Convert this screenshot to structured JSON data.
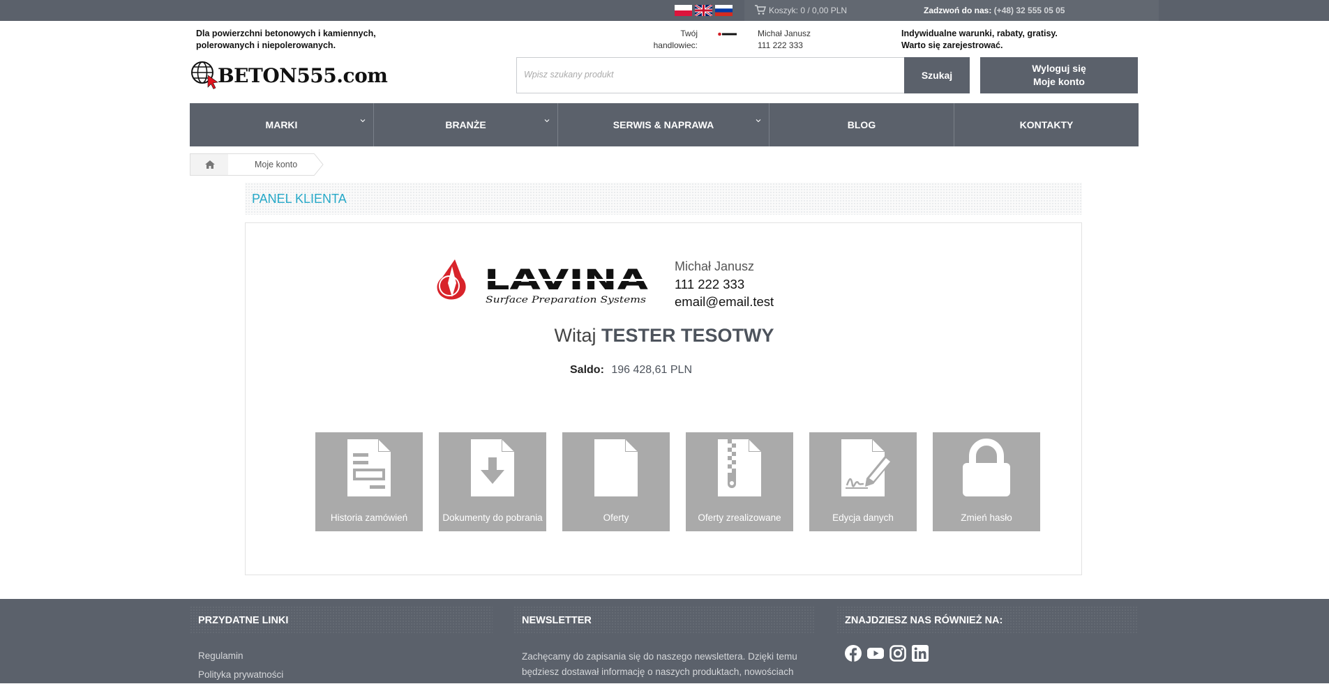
{
  "topbar": {
    "flags": [
      "pl-flag",
      "uk-flag",
      "ru-flag"
    ],
    "cart_text": "Koszyk: 0 / 0,00 PLN",
    "phone_label": "Zadzwoń do nas:",
    "phone_number": "(+48) 32 555 05 05"
  },
  "header": {
    "tagline_line1": "Dla powierzchni betonowych i kamiennych,",
    "tagline_line2": "polerowanych i niepolerowanych.",
    "logo_text": "BETON555.com",
    "rep_label_line1": "Twój",
    "rep_label_line2": "handlowiec:",
    "rep_name": "Michał Janusz",
    "rep_phone": "111 222 333",
    "promo_line1": "Indywidualne warunki, rabaty, gratisy.",
    "promo_line2": "Warto się zarejestrować.",
    "search_placeholder": "Wpisz szukany produkt",
    "search_button": "Szukaj",
    "logout_label": "Wyloguj się",
    "account_label": "Moje konto"
  },
  "nav": {
    "items": [
      {
        "label": "MARKI",
        "dropdown": true
      },
      {
        "label": "BRANŻE",
        "dropdown": true
      },
      {
        "label": "SERWIS & NAPRAWA",
        "dropdown": true
      },
      {
        "label": "BLOG",
        "dropdown": false
      },
      {
        "label": "KONTAKTY",
        "dropdown": false
      }
    ]
  },
  "breadcrumb": {
    "home_icon": "home-icon",
    "current": "Moje konto"
  },
  "panel": {
    "title": "PANEL KLIENTA",
    "brand_logo_text": "LAVINA",
    "brand_logo_subtext": "Surface Preparation Systems",
    "contact_name": "Michał Janusz",
    "contact_phone": "111 222 333",
    "contact_email": "email@email.test",
    "welcome_prefix": "Witaj",
    "welcome_name": "TESTER TESOTWY",
    "balance_label": "Saldo:",
    "balance_value": "196 428,61 PLN",
    "tiles": [
      {
        "label": "Historia zamówień",
        "icon": "order-history-icon"
      },
      {
        "label": "Dokumenty do pobrania",
        "icon": "download-document-icon"
      },
      {
        "label": "Oferty",
        "icon": "document-icon"
      },
      {
        "label": "Oferty zrealizowane",
        "icon": "zip-document-icon"
      },
      {
        "label": "Edycja danych",
        "icon": "signature-edit-icon"
      },
      {
        "label": "Zmień hasło",
        "icon": "lock-icon"
      }
    ]
  },
  "footer": {
    "useful_links_title": "PRZYDATNE LINKI",
    "links": [
      "Regulamin",
      "Polityka prywatności"
    ],
    "newsletter_title": "NEWSLETTER",
    "newsletter_text": "Zachęcamy do zapisania się do naszego newslettera. Dzięki temu będziesz dostawał informację o naszych produktach, nowościach",
    "social_title": "ZNAJDZIESZ NAS RÓWNIEŻ NA:",
    "social_icons": [
      "facebook-icon",
      "youtube-icon",
      "instagram-icon",
      "linkedin-icon"
    ]
  },
  "colors": {
    "dark_gray": "#5b616b",
    "accent_blue": "#27a9c8",
    "tile_gray": "#aaaaaa"
  }
}
